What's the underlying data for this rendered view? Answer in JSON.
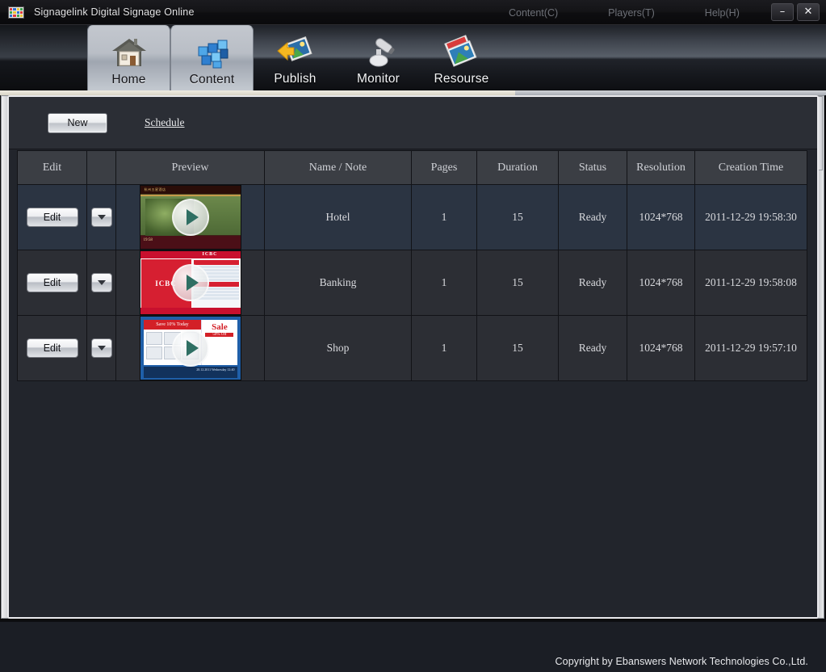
{
  "window": {
    "title": "Signagelink Digital Signage Online",
    "app_icon": "signage-grid-icon",
    "menus": [
      {
        "label": "Content(C)",
        "name": "menu-content"
      },
      {
        "label": "Players(T)",
        "name": "menu-players"
      },
      {
        "label": "Help(H)",
        "name": "menu-help"
      }
    ],
    "minimize_label": "–",
    "close_label": "✕"
  },
  "ribbon": {
    "tabs": [
      {
        "label": "Home",
        "icon": "house-icon",
        "active": true
      },
      {
        "label": "Content",
        "icon": "cubes-icon",
        "active": true
      },
      {
        "label": "Publish",
        "icon": "publish-icon",
        "active": false
      },
      {
        "label": "Monitor",
        "icon": "camera-icon",
        "active": false
      },
      {
        "label": "Resourse",
        "icon": "photos-icon",
        "active": false
      }
    ]
  },
  "toolbar": {
    "new_label": "New",
    "schedule_label": "Schedule"
  },
  "table": {
    "headers": [
      "Edit",
      "",
      "Preview",
      "Name / Note",
      "Pages",
      "Duration",
      "Status",
      "Resolution",
      "Creation Time"
    ],
    "edit_label": "Edit",
    "dropdown_icon": "chevron-down-icon",
    "play_icon": "play-icon",
    "rows": [
      {
        "thumb": "hotel-preview",
        "thumb_title": "杭州五星酒店",
        "thumb_time": "19:58",
        "name": "Hotel",
        "pages": "1",
        "duration": "15",
        "status": "Ready",
        "resolution": "1024*768",
        "creation_time": "2011-12-29 19:58:30",
        "selected": true
      },
      {
        "thumb": "banking-preview",
        "thumb_brand": "ICBC",
        "name": "Banking",
        "pages": "1",
        "duration": "15",
        "status": "Ready",
        "resolution": "1024*768",
        "creation_time": "2011-12-29 19:58:08",
        "selected": false
      },
      {
        "thumb": "shop-preview",
        "thumb_banner": "Save 10% Today",
        "thumb_sale": "Sale",
        "thumb_off": "50% Off",
        "thumb_date": "28.12.2011 Wednesday 12:40",
        "name": "Shop",
        "pages": "1",
        "duration": "15",
        "status": "Ready",
        "resolution": "1024*768",
        "creation_time": "2011-12-29 19:57:10",
        "selected": false
      }
    ]
  },
  "footer": {
    "copyright": "Copyright by Ebanswers Network Technologies Co.,Ltd."
  },
  "colors": {
    "header_row": "#3b3e44",
    "selected_row": "#2b3442",
    "normal_row": "#2c2e34",
    "panel_bg": "#22252c",
    "panel_border": "#e9e9ec"
  }
}
